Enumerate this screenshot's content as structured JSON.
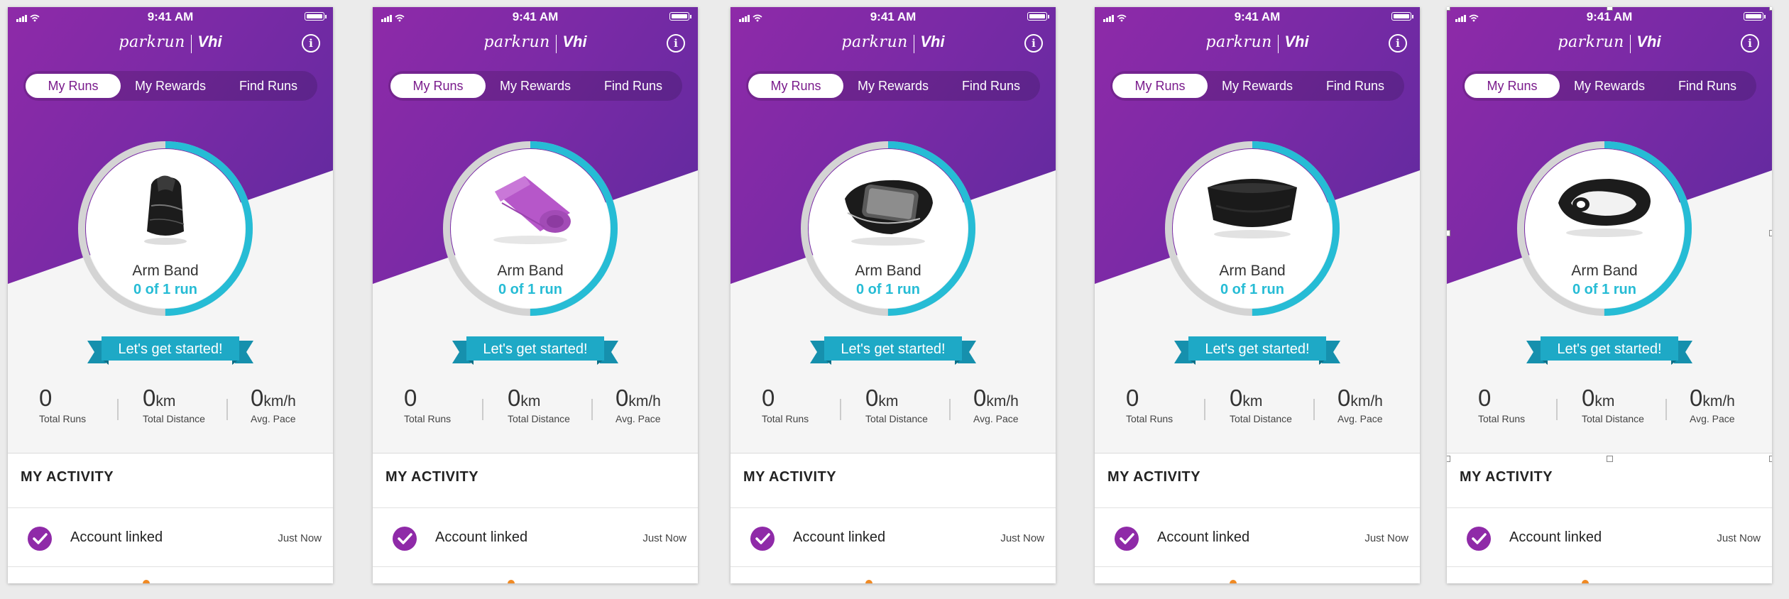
{
  "status": {
    "time": "9:41 AM"
  },
  "header": {
    "logo_left": "parkrun",
    "logo_right": "Vhi",
    "info_label": "i"
  },
  "tabs": [
    "My Runs",
    "My Rewards",
    "Find Runs"
  ],
  "prize": {
    "name": "Arm Band",
    "progress": "0 of 1 run",
    "progress_fraction": 0.5
  },
  "banner": "Let's get started!",
  "stats": [
    {
      "value": "0",
      "unit": "",
      "label": "Total Runs"
    },
    {
      "value": "0",
      "unit": "km",
      "label": "Total Distance"
    },
    {
      "value": "0",
      "unit": "km/h",
      "label": "Avg. Pace"
    }
  ],
  "activity": {
    "title": "MY ACTIVITY",
    "items": [
      {
        "label": "Account linked",
        "time": "Just Now"
      }
    ]
  },
  "screens": [
    {
      "product": "shoe-bag"
    },
    {
      "product": "towel"
    },
    {
      "product": "phone-armband"
    },
    {
      "product": "headband"
    },
    {
      "product": "shoe-light"
    }
  ],
  "colors": {
    "purple": "#8e2aa8",
    "purple_dark": "#5e2a9e",
    "teal": "#26bcd5",
    "ring_gray": "#d4d4d4",
    "ribbon": "#1ea9c6"
  }
}
